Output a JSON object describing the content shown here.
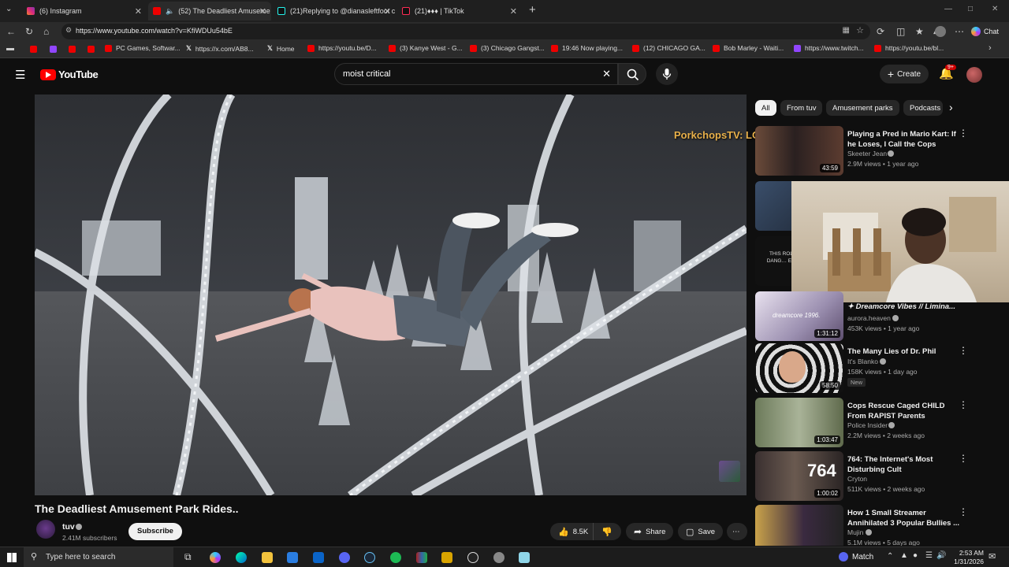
{
  "browser": {
    "tabs": [
      {
        "label": "(6) Instagram",
        "active": false
      },
      {
        "label": "(52) The Deadliest Amuseme",
        "active": true
      },
      {
        "label": "(21)Replying to @dianasleftfoot c",
        "active": false
      },
      {
        "label": "(21)♦♦♦ | TikTok",
        "active": false
      }
    ],
    "new_tab": "+",
    "url": "https://www.youtube.com/watch?v=KfiWDUu54bE",
    "chat_label": "Chat",
    "bookmarks": [
      "PC Games, Softwar...",
      "https://x.com/AB8...",
      "Home",
      "https://youtu.be/D...",
      "(3) Kanye West - G...",
      "(3) Chicago Gangst...",
      "19:46 Now playing...",
      "(12) CHICAGO GA...",
      "Bob Marley - Waiti...",
      "https://www.twitch...",
      "https://youtu.be/bl..."
    ]
  },
  "youtube": {
    "logo_text": "YouTube",
    "search_value": "moist critical",
    "create_label": "Create",
    "notif_count": "9+",
    "overlay_text": "PorkchopsTV: LOVE AND LIGHT!",
    "chips": [
      "All",
      "From tuv",
      "Amusement parks",
      "Podcasts"
    ],
    "video": {
      "title": "The Deadliest Amusement Park Rides..",
      "channel": "tuv",
      "subscribers": "2.41M subscribers",
      "subscribe_label": "Subscribe",
      "likes": "8.5K",
      "share_label": "Share",
      "save_label": "Save"
    },
    "recommendations": [
      {
        "title": "Playing a Pred in Mario Kart: If he Loses, I Call the Cops",
        "channel": "Skeeter Jean",
        "meta": "2.9M views • 1 year ago",
        "duration": "43:59"
      },
      {
        "title": "✦ Dreamcore Vibes // Limina...",
        "channel": "aurora.heaven",
        "meta": "453K views • 1 year ago",
        "duration": "1:31:12",
        "thumb_text": "dreamcore 1996."
      },
      {
        "title": "The Many Lies of Dr. Phil",
        "channel": "It's Blanko",
        "meta": "158K views • 1 day ago",
        "duration": "58:50",
        "badge": "New"
      },
      {
        "title": "Cops Rescue Caged CHILD From RAPIST Parents",
        "channel": "Police Insider",
        "meta": "2.2M views • 2 weeks ago",
        "duration": "1:03:47"
      },
      {
        "title": "764: The Internet's Most Disturbing Cult",
        "channel": "Cryton",
        "meta": "511K views • 2 weeks ago",
        "duration": "1:00:02",
        "thumb_text": "764"
      },
      {
        "title": "How 1 Small Streamer Annihilated 3 Popular Bullies ...",
        "channel": "Mujin",
        "meta": "5.1M views • 5 days ago"
      }
    ],
    "partial_thumb_text": "THIS ROLL… DANG… EVE…"
  },
  "taskbar": {
    "search_placeholder": "Type here to search",
    "weather": "Match",
    "time": "2:53 AM",
    "date": "1/31/2026"
  },
  "colors": {
    "yt_red": "#ff0000",
    "overlay_gold": "#e8b04a",
    "bg": "#0f0f0f"
  }
}
